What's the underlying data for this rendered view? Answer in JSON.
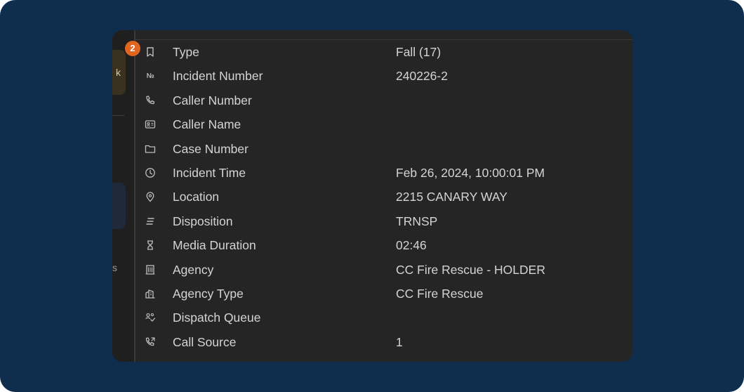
{
  "badge": "2",
  "sidebar": {
    "button_letter": "k",
    "partial_letter": "s"
  },
  "details": [
    {
      "icon": "bookmark-icon",
      "label": "Type",
      "value": "Fall (17)"
    },
    {
      "icon": "numero-icon",
      "icon_text": "№",
      "label": "Incident Number",
      "value": "240226-2"
    },
    {
      "icon": "phone-icon",
      "label": "Caller Number",
      "value": ""
    },
    {
      "icon": "contact-card-icon",
      "label": "Caller Name",
      "value": ""
    },
    {
      "icon": "folder-icon",
      "label": "Case Number",
      "value": ""
    },
    {
      "icon": "clock-icon",
      "label": "Incident Time",
      "value": "Feb 26, 2024, 10:00:01 PM"
    },
    {
      "icon": "location-pin-icon",
      "label": "Location",
      "value": "2215 CANARY WAY"
    },
    {
      "icon": "lines-icon",
      "label": "Disposition",
      "value": "TRNSP"
    },
    {
      "icon": "hourglass-icon",
      "label": "Media Duration",
      "value": "02:46"
    },
    {
      "icon": "building-icon",
      "label": "Agency",
      "value": "CC Fire Rescue - HOLDER"
    },
    {
      "icon": "building-type-icon",
      "label": "Agency Type",
      "value": "CC Fire Rescue"
    },
    {
      "icon": "people-queue-icon",
      "label": "Dispatch Queue",
      "value": ""
    },
    {
      "icon": "phone-source-icon",
      "label": "Call Source",
      "value": "1"
    }
  ]
}
